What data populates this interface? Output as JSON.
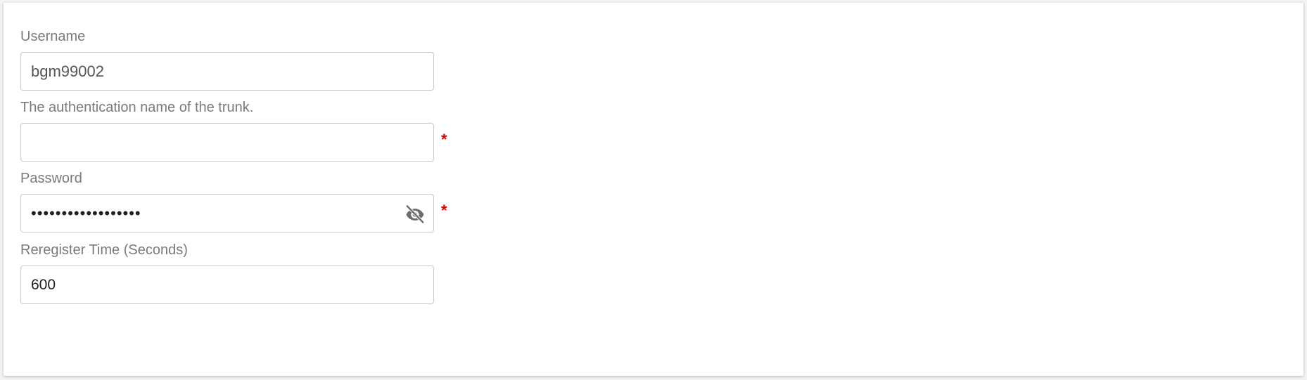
{
  "form": {
    "username": {
      "label": "Username",
      "value": "bgm99002"
    },
    "auth_name": {
      "label": "The authentication name of the trunk.",
      "value": "",
      "required_marker": "*"
    },
    "password": {
      "label": "Password",
      "value": "••••••••••••••••••",
      "required_marker": "*",
      "toggle_icon": "eye-off-icon"
    },
    "reregister": {
      "label": "Reregister Time (Seconds)",
      "value": "600"
    }
  },
  "colors": {
    "label": "#7a7a7a",
    "border": "#c9c9c9",
    "required": "#d40000",
    "icon": "#6d6d6d"
  }
}
